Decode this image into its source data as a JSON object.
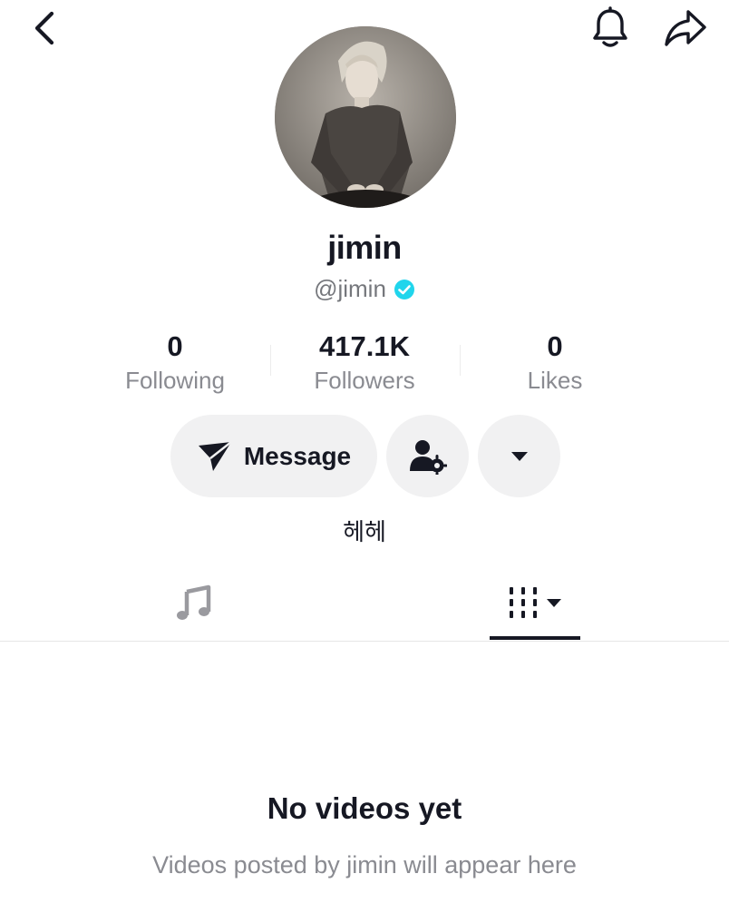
{
  "topbar": {
    "back_icon": "chevron-left-icon",
    "notification_icon": "bell-icon",
    "share_icon": "share-arrow-icon"
  },
  "profile": {
    "display_name": "jimin",
    "handle": "@jimin",
    "verified": true,
    "verified_color": "#20d5ec",
    "bio": "헤헤"
  },
  "stats": [
    {
      "value": "0",
      "label": "Following"
    },
    {
      "value": "417.1K",
      "label": "Followers"
    },
    {
      "value": "0",
      "label": "Likes"
    }
  ],
  "actions": {
    "message_label": "Message",
    "message_icon": "send-icon",
    "friends_icon": "user-settings-icon",
    "more_icon": "caret-down-icon"
  },
  "tabs": [
    {
      "name": "sounds",
      "icon": "music-note-icon",
      "active": false
    },
    {
      "name": "videos",
      "icon": "grid-bars-icon",
      "active": true
    }
  ],
  "empty_state": {
    "title": "No videos yet",
    "subtitle": "Videos posted by jimin will appear here"
  }
}
